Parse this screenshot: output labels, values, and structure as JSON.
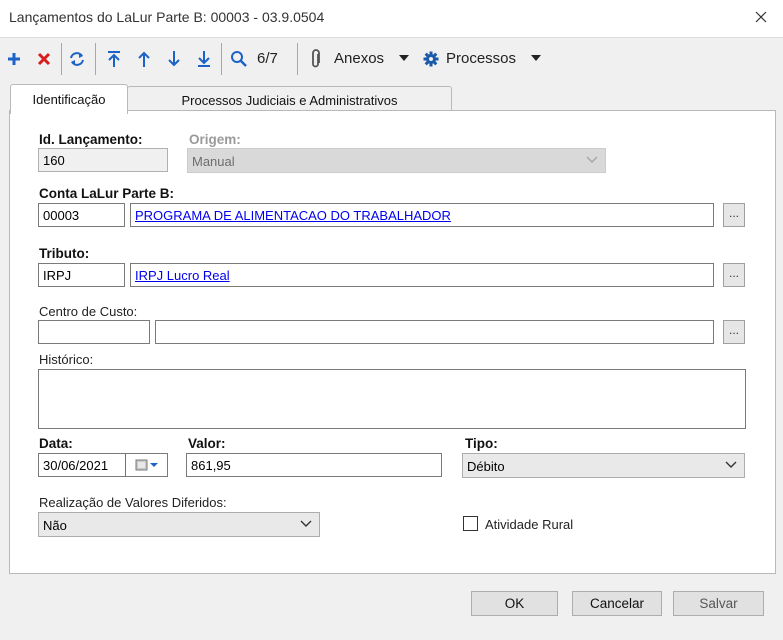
{
  "window": {
    "title": "Lançamentos do LaLur Parte B: 00003 - 03.9.0504"
  },
  "toolbar": {
    "record_counter": "6/7",
    "anexos_label": "Anexos",
    "processos_label": "Processos"
  },
  "colors": {
    "add": "#1b63c6",
    "delete": "#d91c1c",
    "nav": "#1b63c6",
    "link": "#0000ee"
  },
  "tabs": [
    {
      "label": "Identificação",
      "active": true
    },
    {
      "label": "Processos Judiciais e Administrativos",
      "active": false
    }
  ],
  "form": {
    "id_lancamento": {
      "label": "Id. Lançamento:",
      "value": "160"
    },
    "origem": {
      "label": "Origem:",
      "value": "Manual"
    },
    "conta": {
      "label": "Conta LaLur Parte B:",
      "code": "00003",
      "description": "PROGRAMA DE ALIMENTACAO DO TRABALHADOR"
    },
    "tributo": {
      "label": "Tributo:",
      "code": "IRPJ",
      "description": "IRPJ Lucro Real"
    },
    "centro_custo": {
      "label": "Centro de Custo:",
      "code": "",
      "description": ""
    },
    "historico": {
      "label": "Histórico:",
      "value": ""
    },
    "data": {
      "label": "Data:",
      "value": "30/06/2021"
    },
    "valor": {
      "label": "Valor:",
      "value": "861,95"
    },
    "tipo": {
      "label": "Tipo:",
      "value": "Débito"
    },
    "realizacao": {
      "label": "Realização de Valores Diferidos:",
      "value": "Não"
    },
    "atividade_rural": {
      "label": "Atividade Rural",
      "checked": false
    },
    "ellipsis": "..."
  },
  "buttons": {
    "ok": "OK",
    "cancel": "Cancelar",
    "save": "Salvar"
  }
}
